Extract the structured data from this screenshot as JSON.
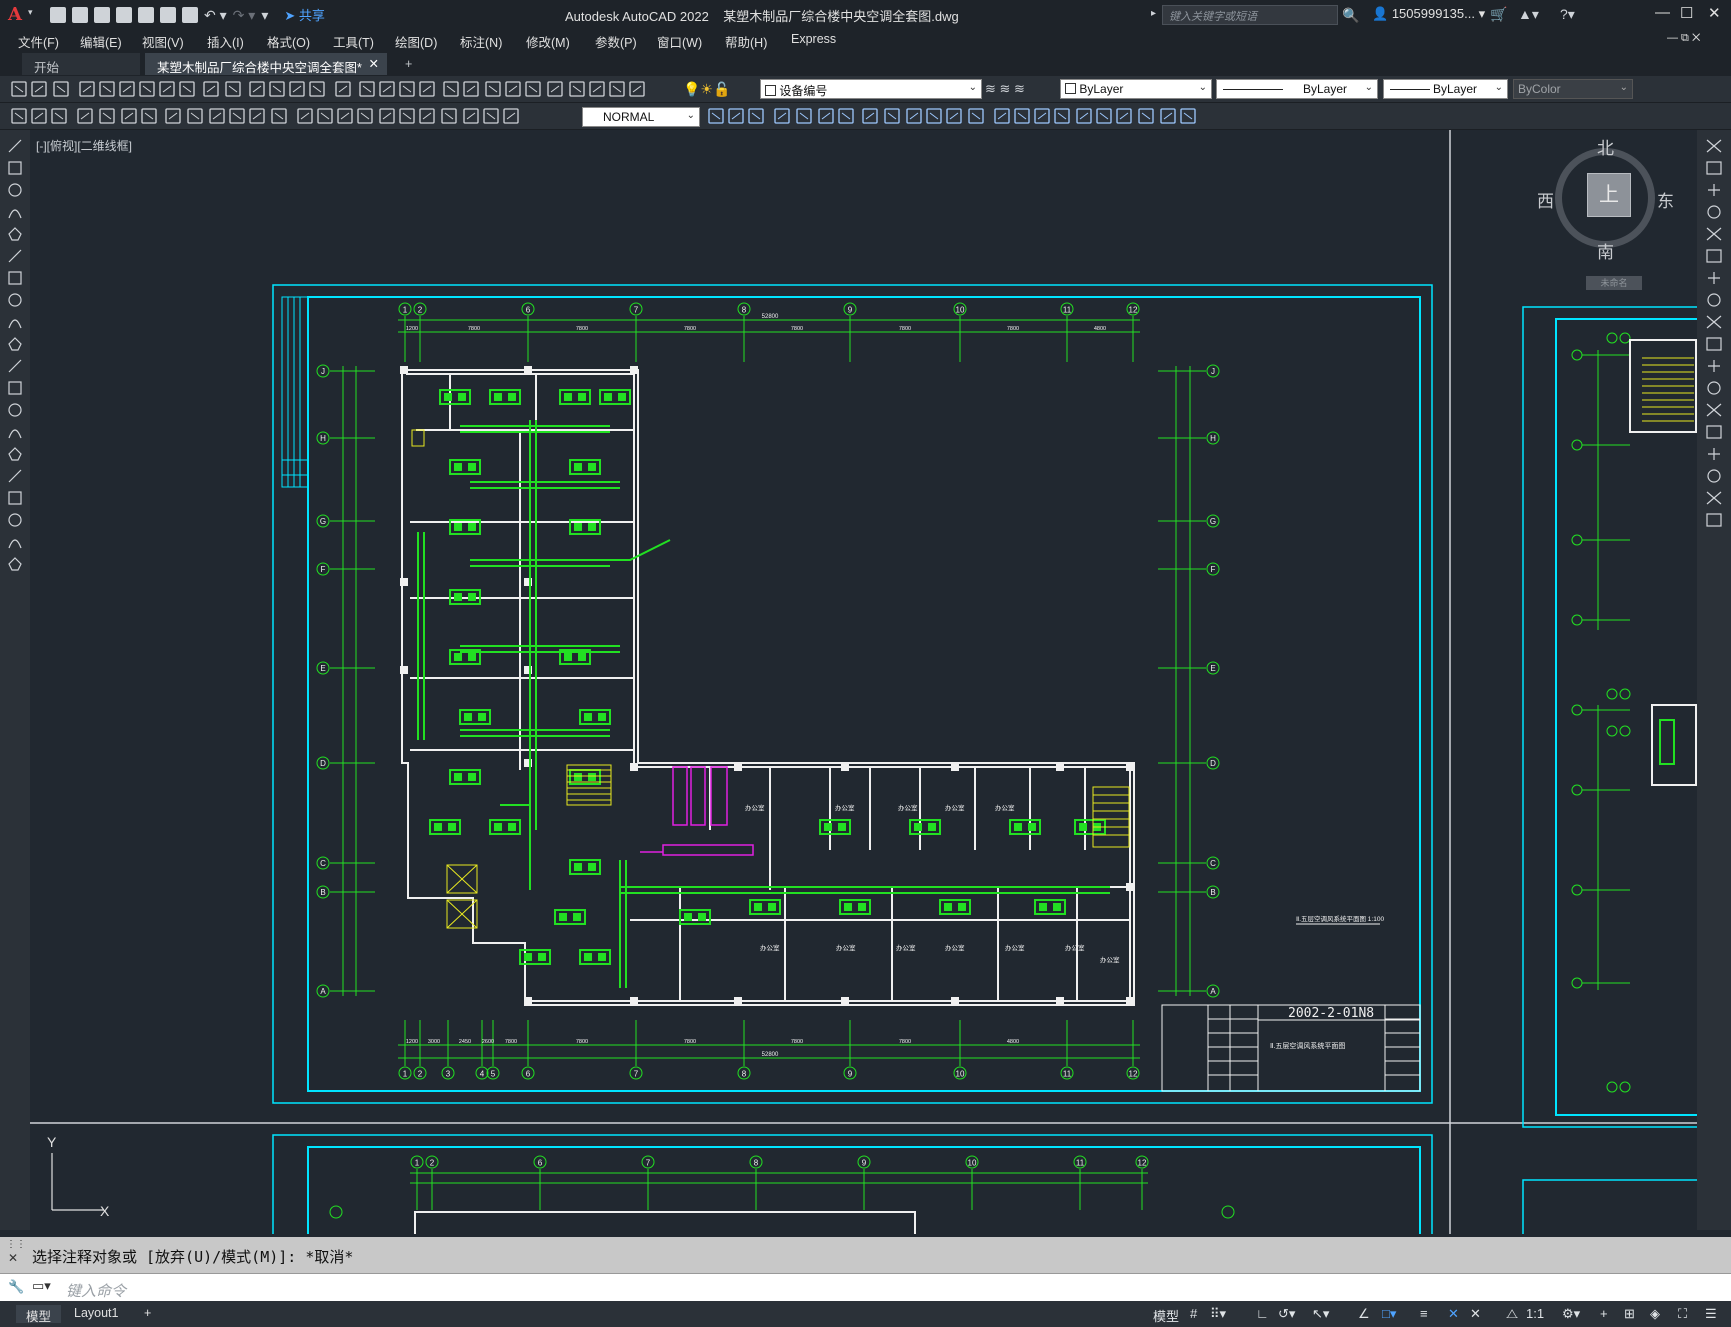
{
  "app": {
    "logo": "A",
    "title": "Autodesk AutoCAD 2022",
    "document": "某塑木制品厂综合楼中央空调全套图.dwg",
    "share_label": "共享",
    "search_placeholder": "键入关键字或短语",
    "user": "1505999135..."
  },
  "menu": [
    "文件(F)",
    "编辑(E)",
    "视图(V)",
    "插入(I)",
    "格式(O)",
    "工具(T)",
    "绘图(D)",
    "标注(N)",
    "修改(M)",
    "参数(P)",
    "窗口(W)",
    "帮助(H)",
    "Express"
  ],
  "tabs": {
    "start": "开始",
    "active": "某塑木制品厂综合楼中央空调全套图*"
  },
  "toolbar": {
    "layer": "设备编号",
    "color": "ByLayer",
    "linetype": "ByLayer",
    "lineweight": "ByLayer",
    "plotstyle": "ByColor",
    "textstyle": "NORMAL"
  },
  "viewport": {
    "label": "[-][俯视][二维线框]",
    "compass": {
      "north": "北",
      "south": "南",
      "east": "东",
      "west": "西",
      "top": "上",
      "wcs": "未命名"
    },
    "ucs_y": "Y",
    "ucs_x": "X"
  },
  "drawing": {
    "drawing_no": "2002-2-01N8",
    "sheet_title": "Ⅱ.五层空调风系统平面图",
    "plan_caption": "Ⅱ.五层空调风系统平面图 1:100",
    "grid_top": [
      "1",
      "2",
      "6",
      "7",
      "8",
      "9",
      "10",
      "11",
      "12"
    ],
    "grid_bottom": [
      "1",
      "2",
      "3",
      "4",
      "5",
      "6",
      "7",
      "8",
      "9",
      "10",
      "11",
      "12"
    ],
    "grid_left": [
      "J",
      "H",
      "G",
      "F",
      "E",
      "D",
      "C",
      "B",
      "A"
    ],
    "dims_top": [
      "1200",
      "7800",
      "7800",
      "7800",
      "7800",
      "7800",
      "7800",
      "4800"
    ],
    "total_dim": "52800",
    "dims_bottom": [
      "1200",
      "3000",
      "2450",
      "2600",
      "7800",
      "7800",
      "7800",
      "7800",
      "7800",
      "4800"
    ],
    "room_label": "办公室"
  },
  "command": {
    "history": "选择注释对象或 [放弃(U)/模式(M)]: *取消*",
    "placeholder": "键入命令"
  },
  "status": {
    "model_tab": "模型",
    "layout_tab": "Layout1",
    "model_button": "模型",
    "scale": "1:1"
  },
  "colors": {
    "background": "#212830",
    "cyan_frame": "#00e5ff",
    "green_lines": "#22e022",
    "walls": "#ffffff",
    "magenta": "#e020e0",
    "yellow": "#e8e820"
  }
}
